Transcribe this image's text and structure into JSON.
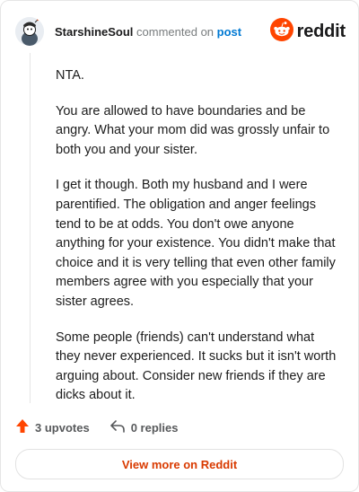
{
  "header": {
    "username": "StarshineSoul",
    "verb": "commented on",
    "target": "post",
    "brand": "reddit"
  },
  "comment": {
    "paragraphs": [
      "NTA.",
      "You are allowed to have boundaries and be angry. What your mom did was grossly unfair to both you and your sister.",
      "I get it though. Both my husband and I were parentified. The obligation and anger feelings tend to be at odds. You don't owe anyone anything for your existence. You didn't make that choice and it is very telling that even other family members agree with you especially that your sister agrees.",
      "Some people (friends) can't understand what they never experienced. It sucks but it isn't worth arguing about. Consider new friends if they are dicks about it."
    ]
  },
  "actions": {
    "upvotes": "3 upvotes",
    "replies": "0 replies"
  },
  "footer": {
    "view_more": "View more on Reddit"
  },
  "colors": {
    "accent": "#ff4500",
    "link": "#0079d3",
    "view_more": "#d93a00"
  },
  "icons": {
    "avatar": "snoo-avatar",
    "brand": "reddit-logo-icon",
    "upvote": "upvote-arrow-icon",
    "reply": "reply-arrow-icon"
  }
}
